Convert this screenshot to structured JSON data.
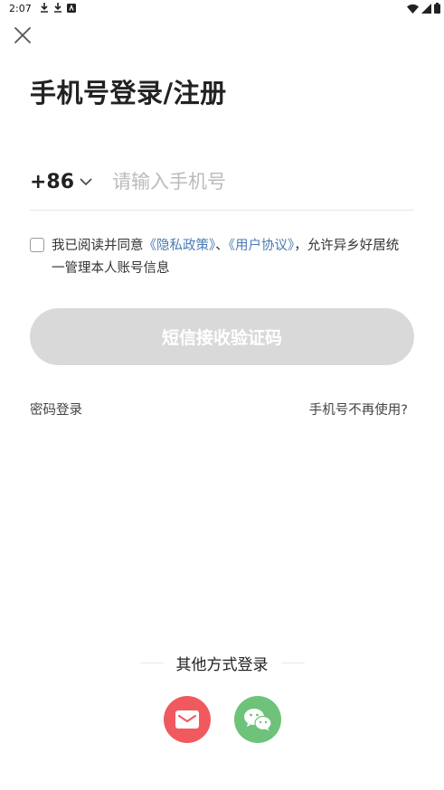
{
  "status_bar": {
    "time": "2:07"
  },
  "title": "手机号登录/注册",
  "phone": {
    "country_code": "+86",
    "placeholder": "请输入手机号"
  },
  "agreement": {
    "prefix": "我已阅读并同意",
    "privacy_link": "《隐私政策》",
    "separator": "、",
    "user_link": "《用户协议》",
    "suffix": "，允许异乡好居统一管理本人账号信息"
  },
  "sms_button": "短信接收验证码",
  "links": {
    "password_login": "密码登录",
    "phone_unavailable": "手机号不再使用?"
  },
  "other_login": {
    "label": "其他方式登录"
  },
  "colors": {
    "accent_link": "#4a7bb5",
    "mail": "#f05a5f",
    "wechat": "#6ec27a",
    "button_disabled": "#d9d9d9"
  },
  "icons": [
    "download-icon",
    "download-icon",
    "app-icon",
    "wifi-icon",
    "signal-icon",
    "battery-icon",
    "close-icon",
    "chevron-down-icon",
    "mail-icon",
    "wechat-icon"
  ]
}
